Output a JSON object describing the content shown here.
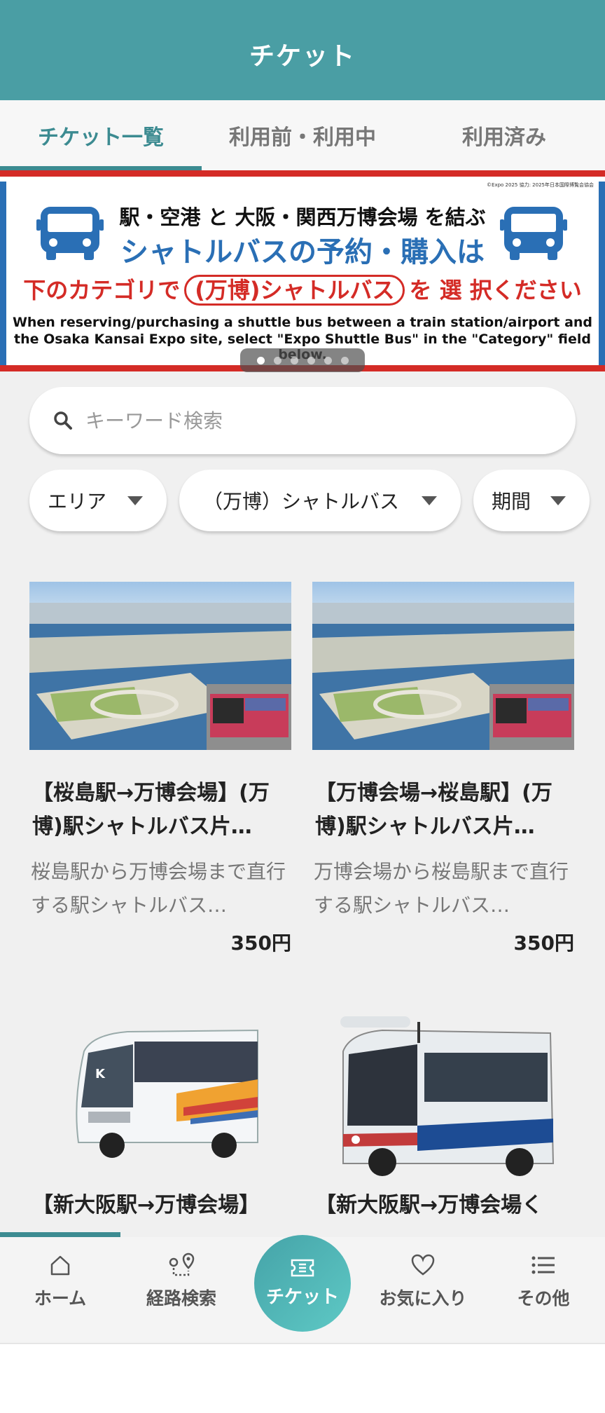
{
  "header": {
    "title": "チケット"
  },
  "tabs": [
    {
      "label": "チケット一覧",
      "active": true
    },
    {
      "label": "利用前・利用中",
      "active": false
    },
    {
      "label": "利用済み",
      "active": false
    }
  ],
  "banner": {
    "credit": "©Expo 2025  協力: 2025年日本国際博覧会協会",
    "line1": "駅・空港 と 大阪・関西万博会場 を結ぶ",
    "line2": "シャトルバスの予約・購入は",
    "line3_pre": "下のカテゴリで",
    "line3_pill": "(万博)シャトルバス",
    "line3_post": "を 選 択ください",
    "english_1": "When reserving/purchasing a shuttle bus between a train station/airport and",
    "english_2": "the Osaka Kansai Expo site, select \"Expo Shuttle Bus\" in the \"Category\" field below.",
    "slides_total": 6,
    "slide_active": 1
  },
  "search": {
    "placeholder": "キーワード検索"
  },
  "filters": [
    {
      "label": "エリア"
    },
    {
      "label": "（万博）シャトルバス"
    },
    {
      "label": "期間"
    }
  ],
  "tickets": [
    {
      "title": "【桜島駅→万博会場】(万博)駅シャトルバス片…",
      "description": "桜島駅から万博会場まで直行する駅シャトルバス…",
      "price": "350円"
    },
    {
      "title": "【万博会場→桜島駅】(万博)駅シャトルバス片…",
      "description": "万博会場から桜島駅まで直行する駅シャトルバス…",
      "price": "350円"
    },
    {
      "title": "【新大阪駅→万博会場】",
      "description": "",
      "price": ""
    },
    {
      "title": "【新大阪駅→万博会場く",
      "description": "",
      "price": ""
    }
  ],
  "nav": {
    "items": [
      {
        "label": "ホーム",
        "icon": "home-icon"
      },
      {
        "label": "経路検索",
        "icon": "route-icon"
      },
      {
        "label": "チケット",
        "icon": "ticket-icon"
      },
      {
        "label": "お気に入り",
        "icon": "heart-icon"
      },
      {
        "label": "その他",
        "icon": "menu-list-icon"
      }
    ]
  },
  "colors": {
    "teal": "#4a9ea4",
    "banner_red": "#d42b26",
    "banner_blue": "#2a6fb5"
  }
}
